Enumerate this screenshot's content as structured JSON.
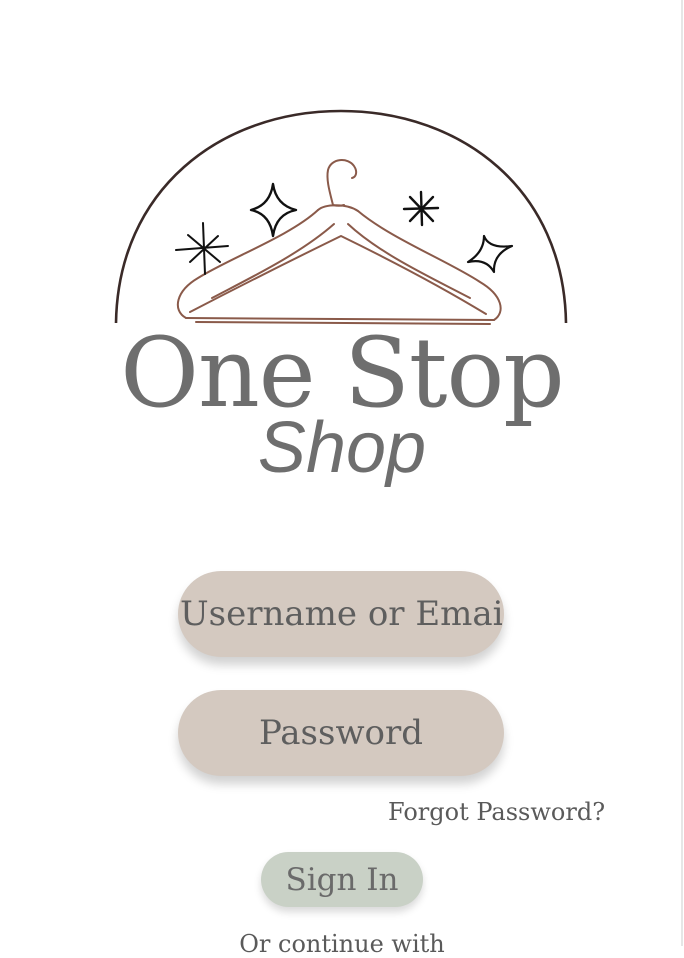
{
  "brand": {
    "line1": "One Stop",
    "line2": "Shop",
    "logo_icon": "hanger-icon",
    "colors": {
      "arc": "#3a2a28",
      "hanger": "#8a5a4a",
      "text": "#6e6e6e"
    }
  },
  "login": {
    "username_placeholder": "Username or Email",
    "password_placeholder": "Password",
    "forgot_label": "Forgot Password?",
    "signin_label": "Sign In",
    "continue_label": "Or continue with",
    "colors": {
      "input_bg": "#d4c9c0",
      "signin_bg": "#c9d1c6"
    }
  }
}
